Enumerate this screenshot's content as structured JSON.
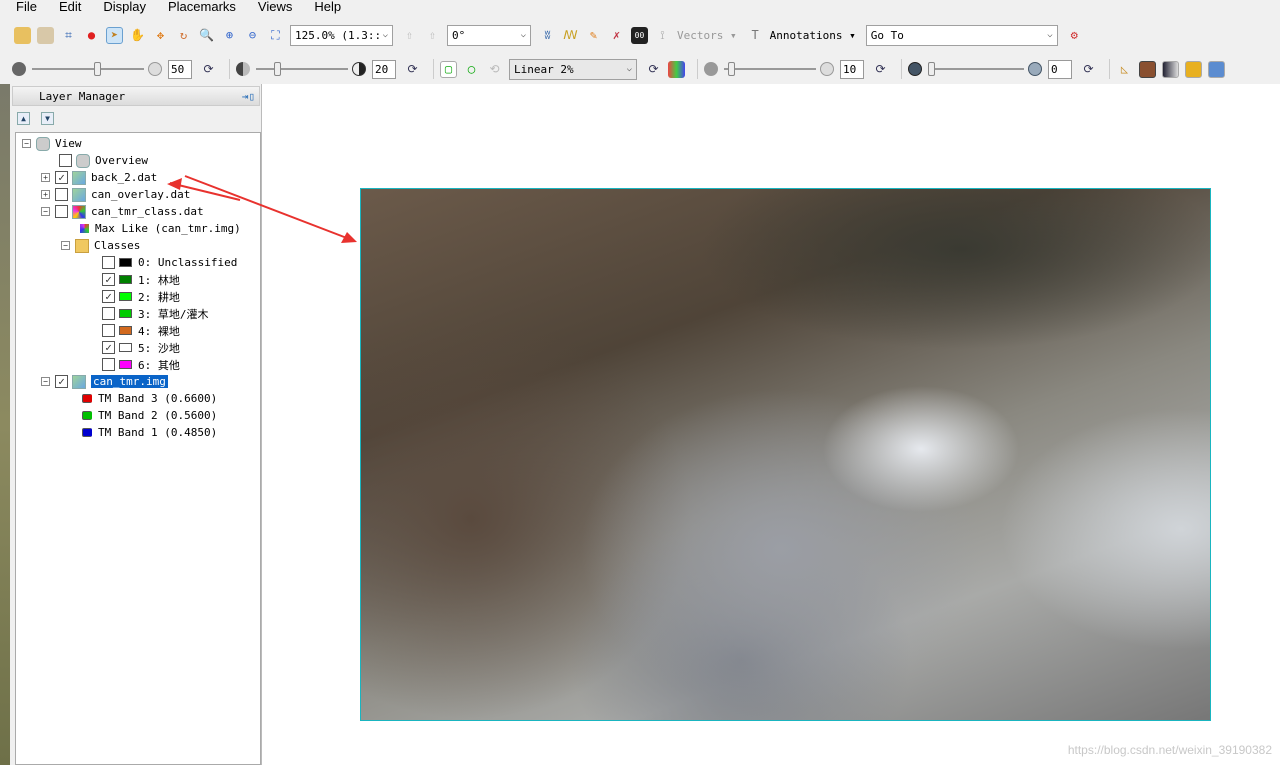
{
  "menu": [
    "File",
    "Edit",
    "Display",
    "Placemarks",
    "Views",
    "Help"
  ],
  "toolbar1": {
    "zoom_value": "125.0% (1.3::",
    "rotation_value": "0°",
    "vectors_label": "Vectors",
    "annotations_label": "Annotations",
    "goto_value": "Go To"
  },
  "toolbar2": {
    "brightness_value": "50",
    "contrast_value": "20",
    "stretch_value": "Linear 2%",
    "sharpen_value": "10",
    "transparency_value": "0"
  },
  "layer_manager": {
    "title": "Layer Manager",
    "view": "View",
    "overview": "Overview",
    "layers": [
      {
        "name": "back_2.dat",
        "checked": true
      },
      {
        "name": "can_overlay.dat",
        "checked": false
      },
      {
        "name": "can_tmr_class.dat",
        "checked": false
      }
    ],
    "max_like": "Max Like (can_tmr.img)",
    "classes_label": "Classes",
    "classes": [
      {
        "label": "0: Unclassified",
        "color": "#000000",
        "checked": false
      },
      {
        "label": "1: 林地",
        "color": "#008000",
        "checked": true
      },
      {
        "label": "2: 耕地",
        "color": "#00ff00",
        "checked": true
      },
      {
        "label": "3: 草地/灌木",
        "color": "#00cc00",
        "checked": false
      },
      {
        "label": "4: 裸地",
        "color": "#d2691e",
        "checked": false
      },
      {
        "label": "5: 沙地",
        "color": "#ffffff",
        "checked": true
      },
      {
        "label": "6: 其他",
        "color": "#ff00ff",
        "checked": false
      }
    ],
    "image_layer": "can_tmr.img",
    "bands": [
      {
        "label": "TM Band 3 (0.6600)",
        "color": "#e00000"
      },
      {
        "label": "TM Band 2 (0.5600)",
        "color": "#00c000"
      },
      {
        "label": "TM Band 1 (0.4850)",
        "color": "#0000d0"
      }
    ]
  },
  "watermark": "https://blog.csdn.net/weixin_39190382",
  "colors": {
    "selection": "#0a64c8",
    "image_border": "#19b5c0",
    "arrow": "#e8322e"
  }
}
